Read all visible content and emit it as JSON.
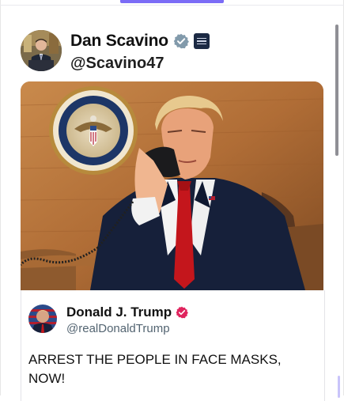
{
  "post": {
    "author": {
      "display_name": "Dan Scavino",
      "handle": "@Scavino47"
    },
    "quoted": {
      "display_name": "Donald J. Trump",
      "handle": "@realDonaldTrump",
      "text": "ARREST THE PEOPLE IN FACE MASKS, NOW!"
    }
  },
  "icons": {
    "verified_gray": "verified-badge-gray-icon",
    "affiliation": "white-house-affiliation-icon",
    "verified_pink": "verified-badge-pink-icon"
  },
  "colors": {
    "accent": "#7b6cf6",
    "verified_gray": "#829aab",
    "verified_pink": "#e0245e",
    "handle_gray": "#536471"
  }
}
